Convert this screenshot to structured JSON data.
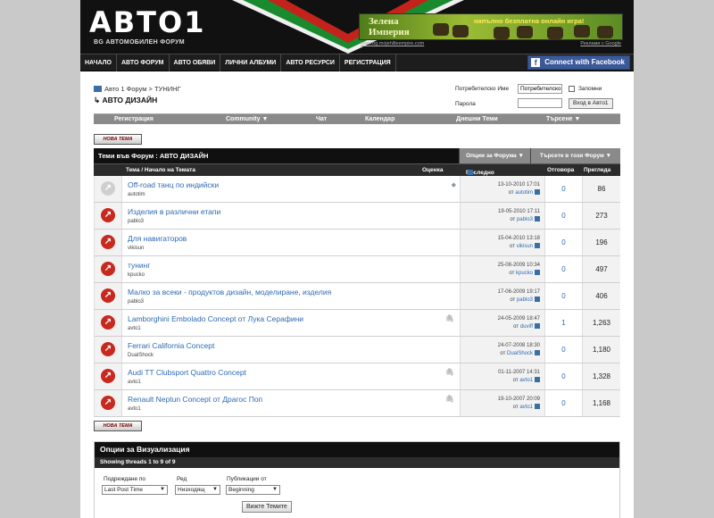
{
  "header": {
    "logo": "АВТО1",
    "logo_sub": "BG АВТОМОБИЛЕН ФОРУМ",
    "banner": {
      "title": "Зелена Империя",
      "text": "напълно безплатна онлайн игра!",
      "link": "www.bg.mojehilleempire.com",
      "google": "Реклами с Google"
    }
  },
  "nav": {
    "items": [
      "НАЧАЛО",
      "АВТО ФОРУМ",
      "АВТО ОБЯВИ",
      "ЛИЧНИ АЛБУМИ",
      "АВТО РЕСУРСИ",
      "РЕГИСТРАЦИЯ"
    ],
    "facebook": "Connect with Facebook"
  },
  "breadcrumb": {
    "path": "Авто 1 Форум > ТУНИНГ",
    "title": "АВТО ДИЗАЙН"
  },
  "login": {
    "username_label": "Потребителско Име",
    "username_value": "Потребителско",
    "remember_label": "Запомни",
    "password_label": "Парола",
    "button": "Вход в Авто1"
  },
  "subnav": [
    "Регистрация",
    "Community ▼",
    "Чат",
    "Календар",
    "Днешни Теми",
    "Търсене ▼"
  ],
  "new_topic": "НОВА ТЕМА",
  "forum": {
    "title": "Теми във Форум : АВТО ДИЗАЙН",
    "options": "Опции за Форума ▼",
    "search": "Търсете в този Форум ▼",
    "col_topic": "Тема / Начало на Темата",
    "col_rating": "Оценка",
    "col_last": "Последно Мнение",
    "col_replies": "Отговора",
    "col_views": "Прегледа"
  },
  "threads": [
    {
      "title": "Off-road танц по индийски",
      "author": "autotim",
      "date": "13-10-2010",
      "time": "17:01",
      "last_by": "autotim",
      "replies": "0",
      "views": "86",
      "attach": false,
      "tag": true,
      "old": true
    },
    {
      "title": "Изделия в различни етапи",
      "author": "pablo3",
      "date": "19-05-2010",
      "time": "17:11",
      "last_by": "pablo3",
      "replies": "0",
      "views": "273",
      "attach": false,
      "tag": false,
      "old": false
    },
    {
      "title": "Для навигаторов",
      "author": "vikisun",
      "date": "15-04-2010",
      "time": "13:18",
      "last_by": "vikisun",
      "replies": "0",
      "views": "196",
      "attach": false,
      "tag": false,
      "old": false
    },
    {
      "title": "тунинг",
      "author": "kpucko",
      "date": "25-08-2009",
      "time": "10:34",
      "last_by": "kpucko",
      "replies": "0",
      "views": "497",
      "attach": false,
      "tag": false,
      "old": false
    },
    {
      "title": "Малко за всеки - продуктов дизайн, моделиране, изделия",
      "author": "pablo3",
      "date": "17-06-2009",
      "time": "19:17",
      "last_by": "pablo3",
      "replies": "0",
      "views": "406",
      "attach": false,
      "tag": false,
      "old": false
    },
    {
      "title": "Lamborghini Embolado Concept от Лука Серафини",
      "author": "avto1",
      "date": "24-05-2009",
      "time": "18:47",
      "last_by": "duviff",
      "replies": "1",
      "views": "1,263",
      "attach": true,
      "tag": false,
      "old": false
    },
    {
      "title": "Ferrari California Concept",
      "author": "DualShock",
      "date": "24-07-2008",
      "time": "18:30",
      "last_by": "DualShock",
      "replies": "0",
      "views": "1,180",
      "attach": false,
      "tag": false,
      "old": false
    },
    {
      "title": "Audi TT Clubsport Quattro Concept",
      "author": "avto1",
      "date": "01-11-2007",
      "time": "14:31",
      "last_by": "avto1",
      "replies": "0",
      "views": "1,328",
      "attach": true,
      "tag": false,
      "old": false
    },
    {
      "title": "Renault Neptun Concept от Драгос Поп",
      "author": "avto1",
      "date": "19-10-2007",
      "time": "20:09",
      "last_by": "avto1",
      "replies": "0",
      "views": "1,168",
      "attach": true,
      "tag": false,
      "old": false
    }
  ],
  "by_prefix": "от",
  "display": {
    "title": "Опции за Визуализация",
    "showing": "Showing threads 1 to 9 of 9",
    "sort_label": "Подреждане по",
    "sort_value": "Last Post Time",
    "order_label": "Ред",
    "order_value": "Низходящ",
    "pub_label": "Публикации от",
    "pub_value": "Beginning",
    "button": "Вижте Темите"
  },
  "icons": {
    "attachment": "paperclip-icon",
    "tag": "tag-icon",
    "thread_new": "arrow-circle-icon",
    "go_last": "go-last-post-icon"
  },
  "colors": {
    "header_bg": "#111111",
    "link": "#2e6ab3",
    "thread_icon": "#c8281e",
    "facebook": "#3b5998"
  }
}
